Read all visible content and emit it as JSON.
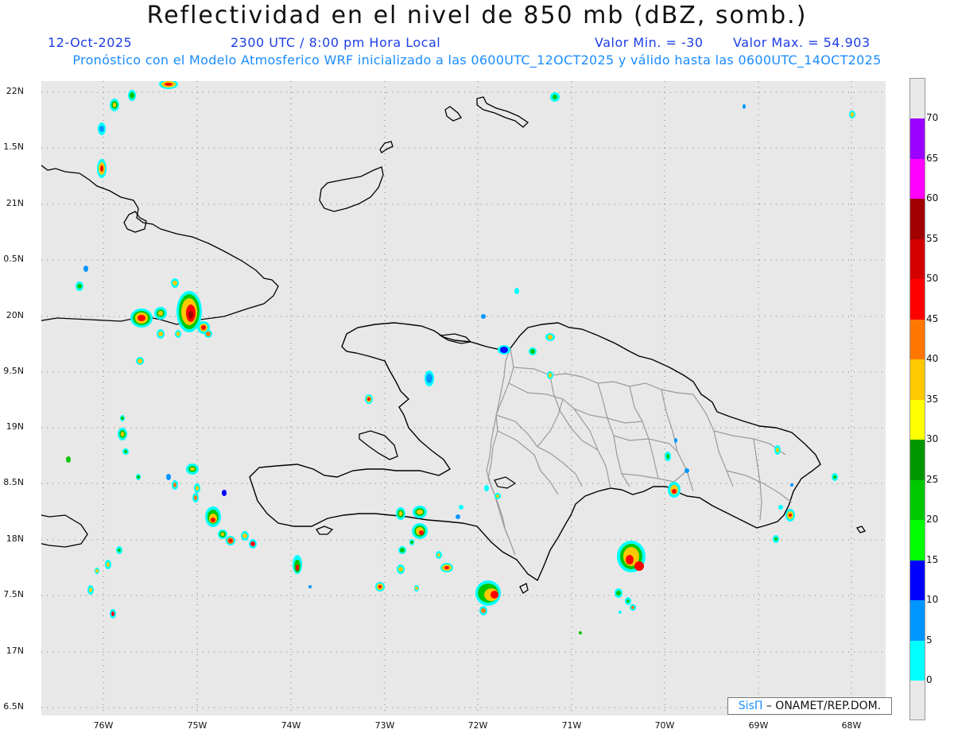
{
  "header": {
    "title": "Reflectividad en el nivel de 850 mb (dBZ, somb.)",
    "date": "12-Oct-2025",
    "time": "2300 UTC / 8:00 pm Hora Local",
    "valmin": "Valor Min. = -30",
    "valmax": "Valor Max. = 54.903",
    "forecast": "Pronóstico con el Modelo Atmosferico WRF inicializado a las 0600UTC_12OCT2025 y válido hasta las  0600UTC_14OCT2025"
  },
  "axes": {
    "y_labels": [
      "22N",
      "1.5N",
      "21N",
      "0.5N",
      "20N",
      "9.5N",
      "19N",
      "8.5N",
      "18N",
      "7.5N",
      "17N",
      "6.5N"
    ],
    "x_labels": [
      "76W",
      "75W",
      "74W",
      "73W",
      "72W",
      "71W",
      "70W",
      "69W",
      "68W"
    ]
  },
  "colorbar": {
    "labels": [
      "70",
      "65",
      "60",
      "55",
      "50",
      "45",
      "40",
      "35",
      "30",
      "25",
      "20",
      "15",
      "10",
      "5",
      "0"
    ],
    "colors": [
      "#9b00ff",
      "#ff00ff",
      "#a00000",
      "#d40000",
      "#ff0000",
      "#ff7700",
      "#ffc800",
      "#ffff00",
      "#009600",
      "#00c800",
      "#00ff00",
      "#0000ff",
      "#0096ff",
      "#00ffff"
    ]
  },
  "credit": {
    "sis": "SisΠ",
    "org": " – ONAMET/REP.DOM."
  },
  "map_colors": {
    "background": "#e8e8e8",
    "coast": "#000000",
    "provinces": "#9a9a9a"
  }
}
